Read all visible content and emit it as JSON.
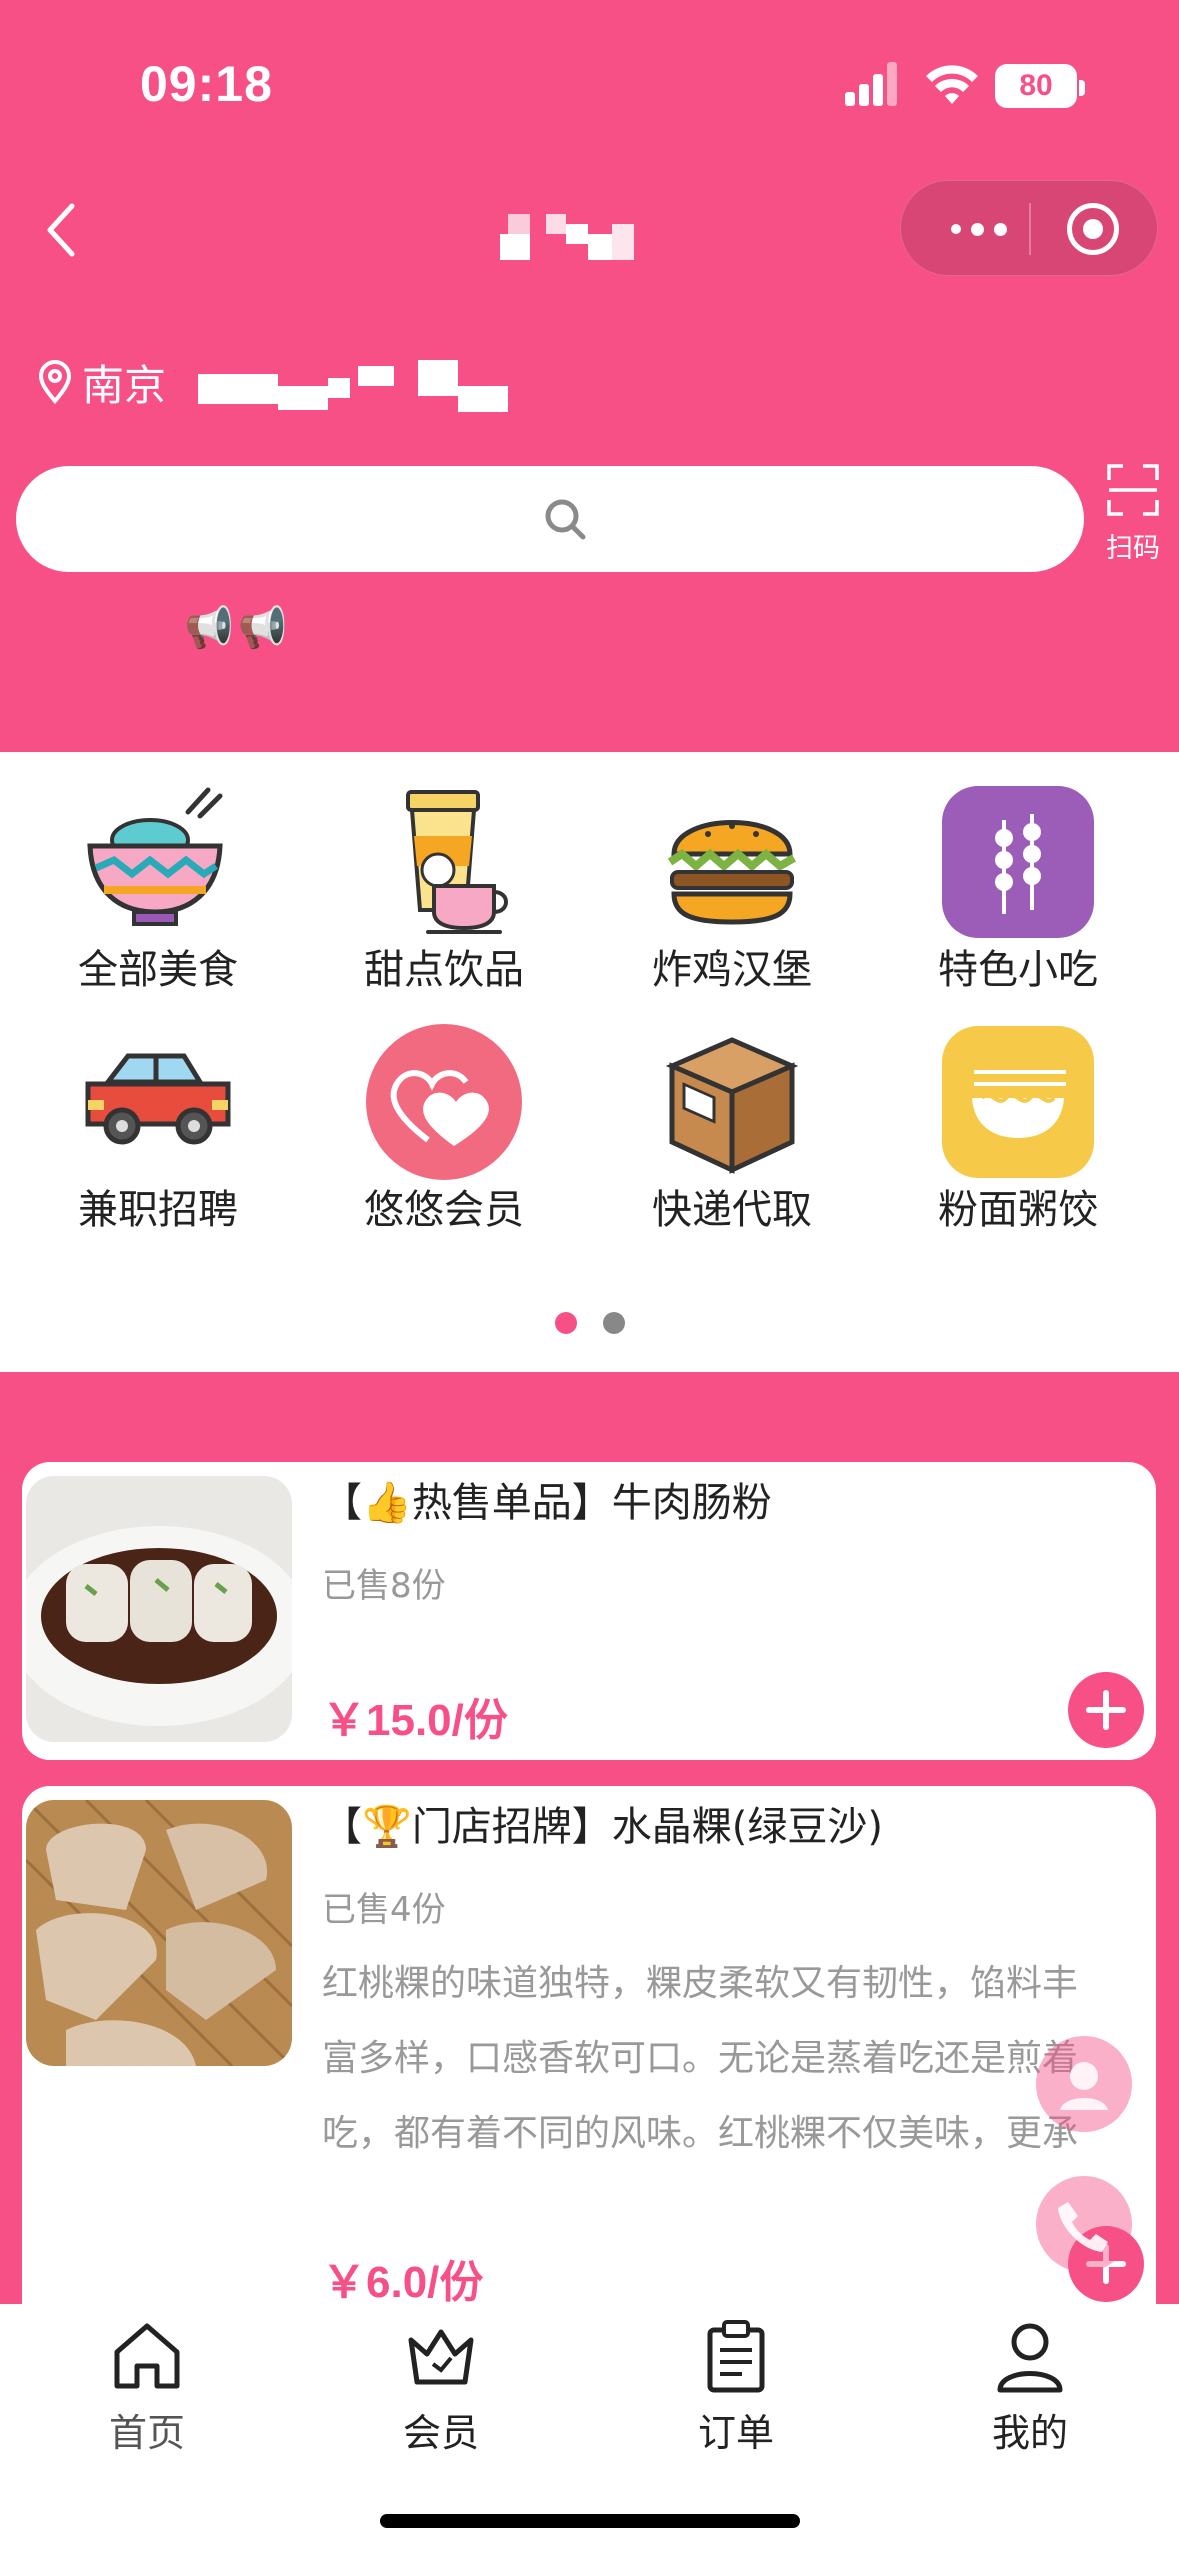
{
  "status_bar": {
    "time": "09:18",
    "battery": "80"
  },
  "header": {
    "location": "南京",
    "search_placeholder": "",
    "scan_label": "扫码",
    "notice_icons": [
      "📢",
      "📢"
    ]
  },
  "categories": [
    {
      "label": "全部美食",
      "icon": "rice-bowl-icon"
    },
    {
      "label": "甜点饮品",
      "icon": "drink-cup-icon"
    },
    {
      "label": "炸鸡汉堡",
      "icon": "burger-icon"
    },
    {
      "label": "特色小吃",
      "icon": "skewer-icon"
    },
    {
      "label": "兼职招聘",
      "icon": "car-icon"
    },
    {
      "label": "悠悠会员",
      "icon": "hearts-icon"
    },
    {
      "label": "快递代取",
      "icon": "box-icon"
    },
    {
      "label": "粉面粥饺",
      "icon": "noodle-bowl-icon"
    }
  ],
  "pager": {
    "pages": 2,
    "active": 0
  },
  "products": [
    {
      "badge_emoji": "👍",
      "name_prefix": "【",
      "name_tag": "热售单品】牛肉肠粉",
      "sold": "已售8份",
      "price": "￥15.0/份"
    },
    {
      "badge_emoji": "🏆",
      "name_prefix": "【",
      "name_tag": "门店招牌】水晶粿(绿豆沙)",
      "sold": "已售4份",
      "desc_lines": [
        "红桃粿的味道独特，粿皮柔软又有韧性，馅料丰",
        "富多样，口感香软可口。无论是蒸着吃还是煎着",
        "吃，都有着不同的风味。红桃粿不仅美味，更承"
      ],
      "price": "￥6.0/份"
    }
  ],
  "tabbar": [
    {
      "label": "首页",
      "icon": "home-icon"
    },
    {
      "label": "会员",
      "icon": "crown-icon"
    },
    {
      "label": "订单",
      "icon": "clipboard-icon"
    },
    {
      "label": "我的",
      "icon": "user-icon"
    }
  ],
  "colors": {
    "brand": "#F65087",
    "muted": "#999999"
  }
}
